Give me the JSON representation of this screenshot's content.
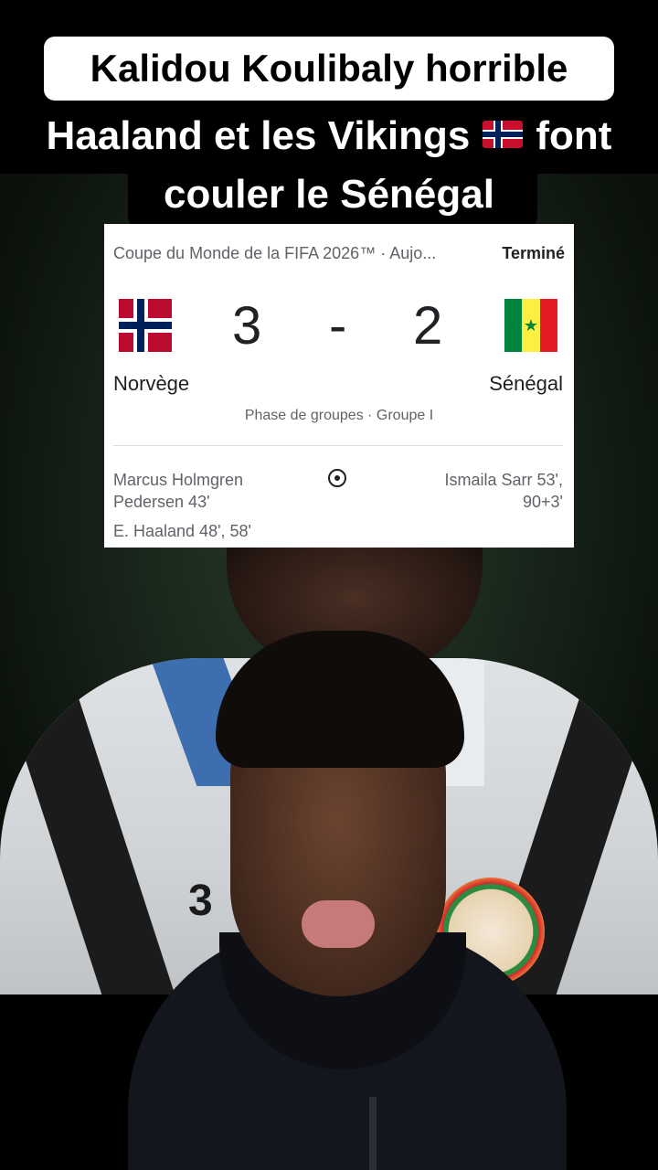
{
  "caption": {
    "line1": "Kalidou Koulibaly horrible",
    "line2_before_flag": "Haaland et les Vikings",
    "line2_flag": "norway-flag-emoji",
    "line2_after_flag": "font",
    "line3": "couler le Sénégal"
  },
  "match": {
    "competition": "Coupe du Monde de la FIFA 2026™ · Aujo...",
    "status": "Terminé",
    "home": {
      "name": "Norvège",
      "score": "3",
      "flag": "norway-flag",
      "scorers_line1": "Marcus Holmgren",
      "scorers_line2": "Pedersen 43'",
      "scorers_line3": "E. Haaland 48', 58'"
    },
    "separator": "-",
    "away": {
      "name": "Sénégal",
      "score": "2",
      "flag": "senegal-flag",
      "scorers_line1": "Ismaila Sarr 53',",
      "scorers_line2": "90+3'"
    },
    "stage": "Phase de groupes · Groupe I",
    "goal_icon": "soccer-ball-icon"
  },
  "background": {
    "jersey_number": "3"
  },
  "colors": {
    "caption_bg": "#ffffff",
    "card_bg": "#ffffff",
    "status_text": "#202124",
    "secondary_text": "#5f6368"
  }
}
